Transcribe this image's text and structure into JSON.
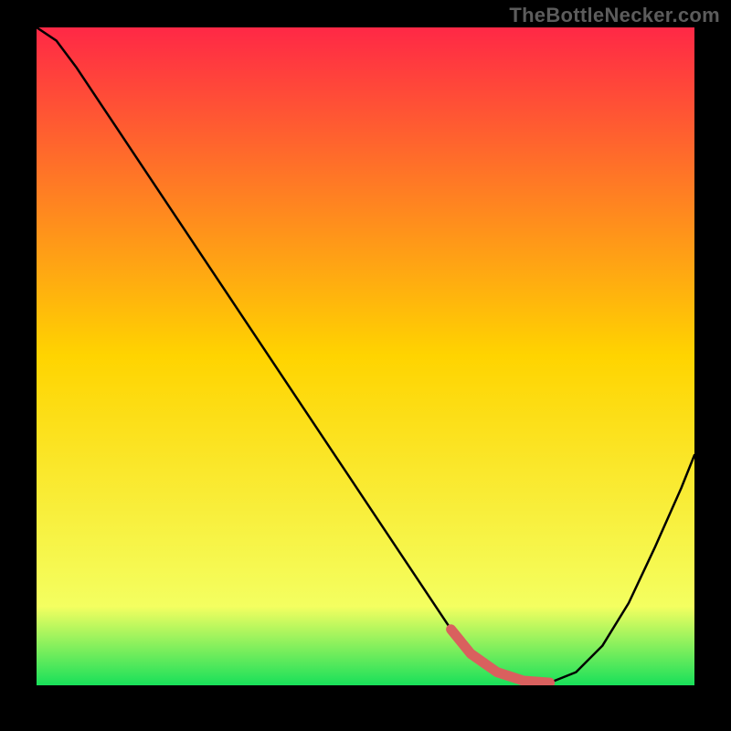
{
  "watermark": "TheBottleNecker.com",
  "colors": {
    "background": "#000000",
    "watermark": "#5c5c5c",
    "curve": "#000000",
    "highlight": "#d9605e",
    "gradient_top": "#ff2846",
    "gradient_mid": "#ffd400",
    "gradient_yellowish": "#f4ff60",
    "gradient_green": "#18e05a"
  },
  "chart_data": {
    "type": "line",
    "title": "",
    "xlabel": "",
    "ylabel": "",
    "xlim": [
      0,
      100
    ],
    "ylim": [
      0,
      100
    ],
    "grid": false,
    "legend": false,
    "series": [
      {
        "name": "main-curve",
        "x": [
          0,
          3,
          6,
          10,
          15,
          20,
          25,
          30,
          35,
          40,
          45,
          50,
          55,
          60,
          63,
          66,
          70,
          74,
          78,
          82,
          86,
          90,
          94,
          98,
          100
        ],
        "y": [
          100,
          98,
          94,
          88,
          80.5,
          73,
          65.5,
          58,
          50.5,
          43,
          35.5,
          28,
          20.5,
          13,
          8.5,
          4.8,
          2.0,
          0.7,
          0.4,
          2.0,
          6.0,
          12.5,
          21,
          30,
          35
        ]
      },
      {
        "name": "highlight-segment",
        "x": [
          63,
          66,
          70,
          74,
          78
        ],
        "y": [
          8.5,
          4.8,
          2.0,
          0.7,
          0.4
        ]
      }
    ]
  }
}
